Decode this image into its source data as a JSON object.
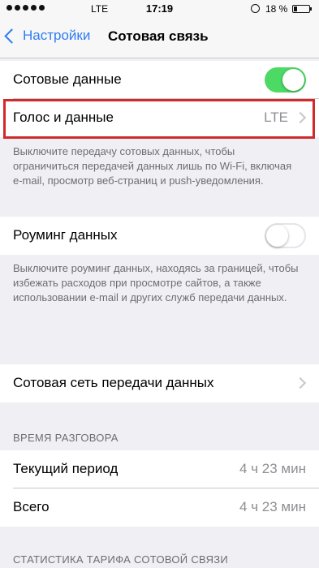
{
  "status_bar": {
    "carrier": "LTE",
    "time": "17:19",
    "battery": "18 %"
  },
  "nav": {
    "back_label": "Настройки",
    "title": "Сотовая связь"
  },
  "cellular_data": {
    "label": "Сотовые данные",
    "enabled": true
  },
  "voice_data": {
    "label": "Голос и данные",
    "value": "LTE"
  },
  "cellular_footer": "Выключите передачу сотовых данных, чтобы ограничиться передачей данных лишь по Wi-Fi, включая e-mail, просмотр веб-страниц и push-уведомления.",
  "roaming": {
    "label": "Роуминг данных",
    "enabled": false
  },
  "roaming_footer": "Выключите роуминг данных, находясь за границей, чтобы избежать расходов при просмотре сайтов, а также использовании e-mail и других служб передачи данных.",
  "cellular_network": {
    "label": "Сотовая сеть передачи данных"
  },
  "call_time": {
    "header": "ВРЕМЯ РАЗГОВОРА",
    "rows": [
      {
        "label": "Текущий период",
        "value": "4 ч 23 мин"
      },
      {
        "label": "Всего",
        "value": "4 ч 23 мин"
      }
    ]
  },
  "stats_header": "СТАТИСТИКА ТАРИФА СОТОВОЙ СВЯЗИ",
  "colors": {
    "accent": "#2f7cf6",
    "toggle_on": "#4cd964",
    "highlight": "#d22a2a"
  }
}
